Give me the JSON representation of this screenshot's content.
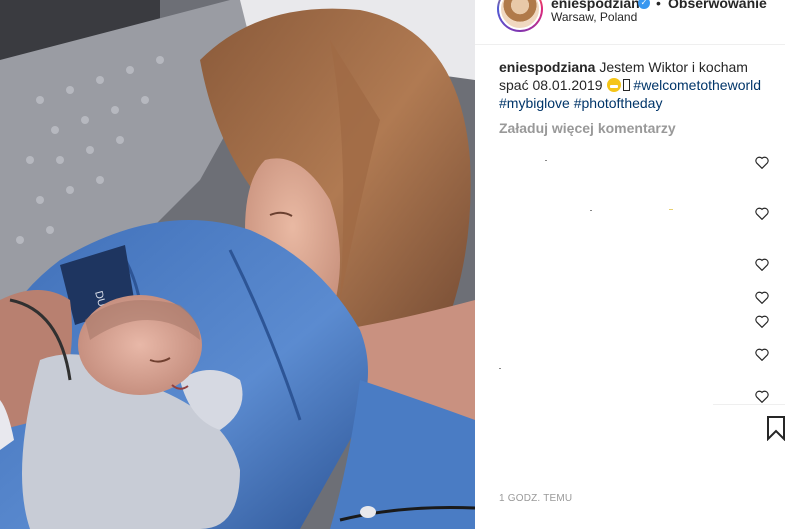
{
  "post": {
    "username": "eniespodziana",
    "follow_label": "Obserwowanie",
    "dot": "•",
    "location": "Warsaw, Poland",
    "caption": {
      "username": "eniespodziana",
      "text": "Jestem Wiktor i kocham spać 08.01.2019",
      "hashtags": [
        "#welcometotheworld",
        "#mybiglove",
        "#photoftheday"
      ]
    },
    "load_more_comments": "Załaduj więcej komentarzy",
    "timestamp": "1 GODZ. TEMU",
    "photo": {
      "description_icons": [
        "photo-mother-newborn"
      ],
      "wristband_text": "DULT"
    }
  },
  "icons": {
    "heart": "heart-icon",
    "bookmark": "bookmark-icon",
    "verified": "verified-icon",
    "emoji": "grinning-emoji-icon"
  },
  "colors": {
    "hashtag": "#003569",
    "muted": "#999999",
    "verified": "#3897f0",
    "text": "#262626"
  }
}
